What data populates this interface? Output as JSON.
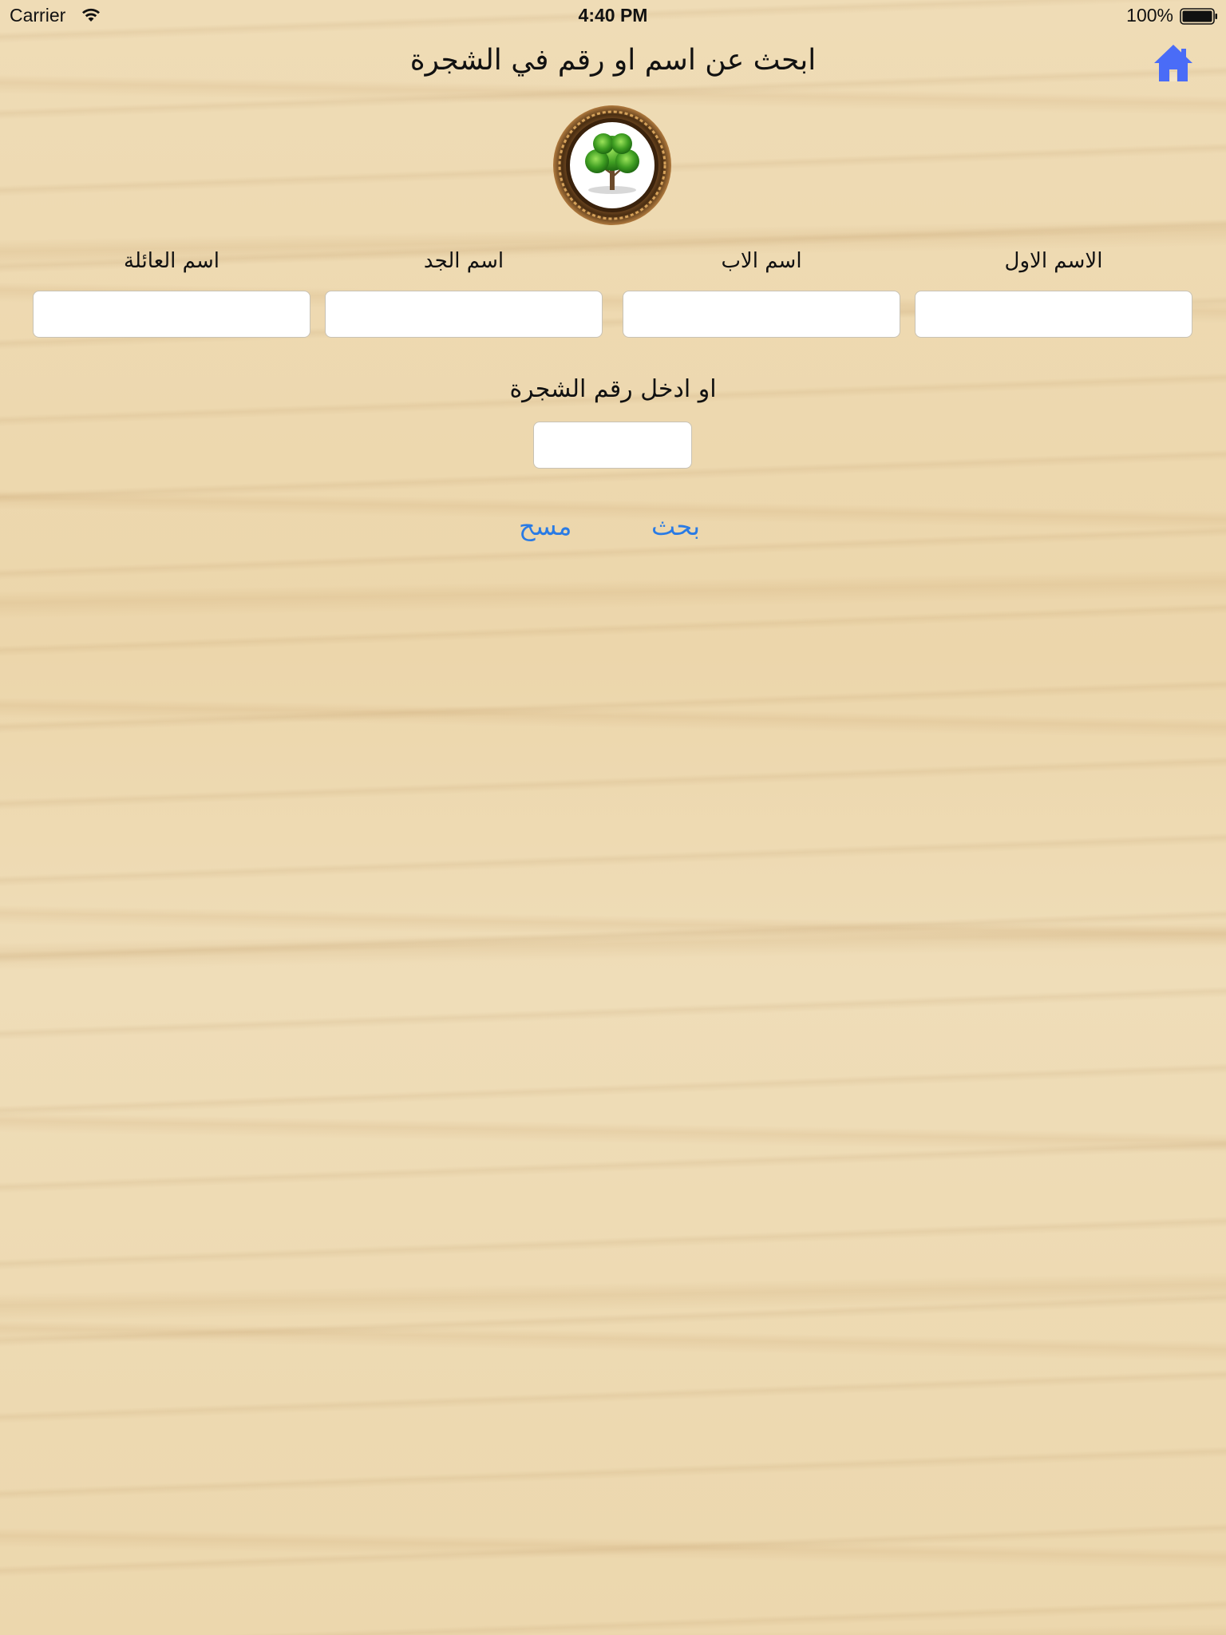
{
  "status_bar": {
    "carrier": "Carrier",
    "time": "4:40 PM",
    "battery": "100%"
  },
  "header": {
    "title": "ابحث عن اسم او رقم في الشجرة",
    "home_icon": "house-icon",
    "accent_color": "#4a6cf7"
  },
  "logo": {
    "icon": "tree-in-ornate-frame"
  },
  "form": {
    "fields": [
      {
        "label": "الاسم الاول",
        "value": ""
      },
      {
        "label": "اسم الاب",
        "value": ""
      },
      {
        "label": "اسم الجد",
        "value": ""
      },
      {
        "label": "اسم العائلة",
        "value": ""
      }
    ],
    "tree_number": {
      "label": "او ادخل رقم الشجرة",
      "value": ""
    }
  },
  "actions": {
    "search_label": "بحث",
    "clear_label": "مسح",
    "link_color": "#2a7be4"
  }
}
